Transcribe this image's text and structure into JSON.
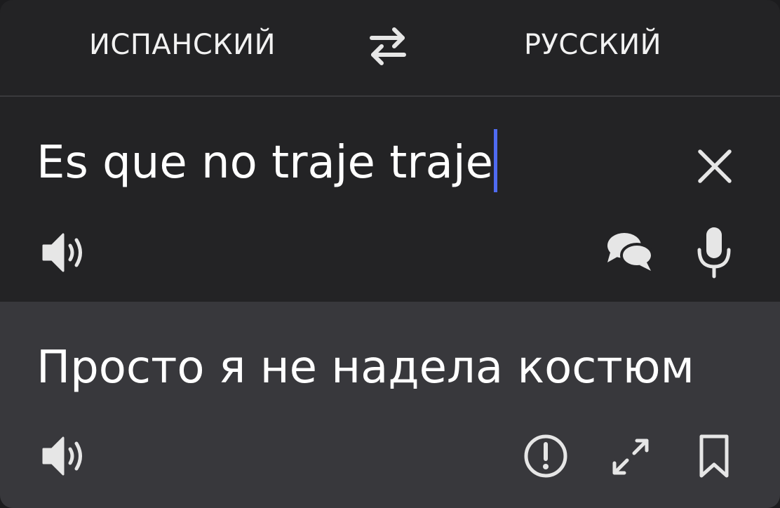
{
  "languages": {
    "source": "ИСПАНСКИЙ",
    "target": "РУССКИЙ"
  },
  "source": {
    "text": "Es que no traje traje"
  },
  "translation": {
    "text": "Просто я не надела костюм"
  },
  "icons": {
    "swap": "swap-arrows-icon",
    "clear": "close-icon",
    "speaker": "speaker-icon",
    "dialog": "dialog-bubbles-icon",
    "mic": "microphone-icon",
    "report": "exclamation-circle-icon",
    "expand": "expand-icon",
    "bookmark": "bookmark-icon"
  },
  "colors": {
    "background": "#232325",
    "translation_background": "#38383c",
    "text": "#ffffff",
    "caret": "#4f6bf2",
    "icon": "#e6e6e6"
  }
}
